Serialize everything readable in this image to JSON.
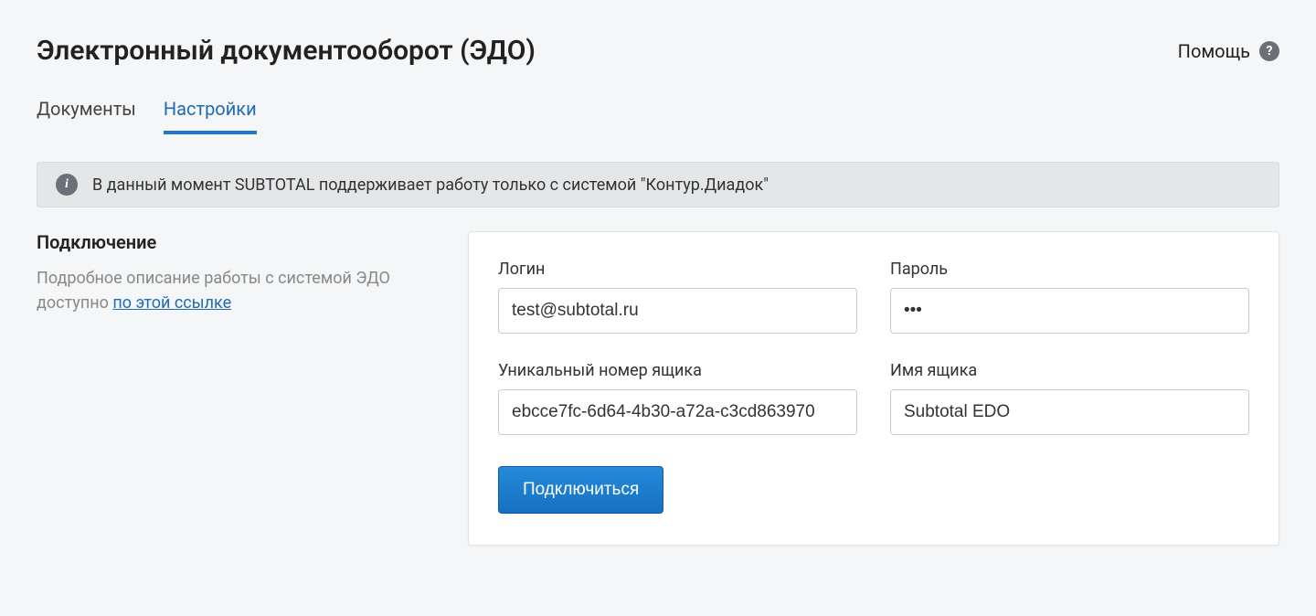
{
  "header": {
    "title": "Электронный документооборот (ЭДО)",
    "help_label": "Помощь"
  },
  "tabs": [
    {
      "label": "Документы",
      "active": false
    },
    {
      "label": "Настройки",
      "active": true
    }
  ],
  "banner": {
    "text": "В данный момент SUBTOTAL поддерживает работу только с системой \"Контур.Диадок\""
  },
  "sidebar": {
    "section_title": "Подключение",
    "desc_prefix": "Подробное описание работы с системой ЭДО доступно ",
    "desc_link": "по этой ссылке"
  },
  "form": {
    "login": {
      "label": "Логин",
      "value": "test@subtotal.ru"
    },
    "password": {
      "label": "Пароль",
      "value": "•••"
    },
    "box_id": {
      "label": "Уникальный номер ящика",
      "value": "ebcce7fc-6d64-4b30-a72a-c3cd863970"
    },
    "box_name": {
      "label": "Имя ящика",
      "value": "Subtotal EDO"
    },
    "submit_label": "Подключиться"
  }
}
